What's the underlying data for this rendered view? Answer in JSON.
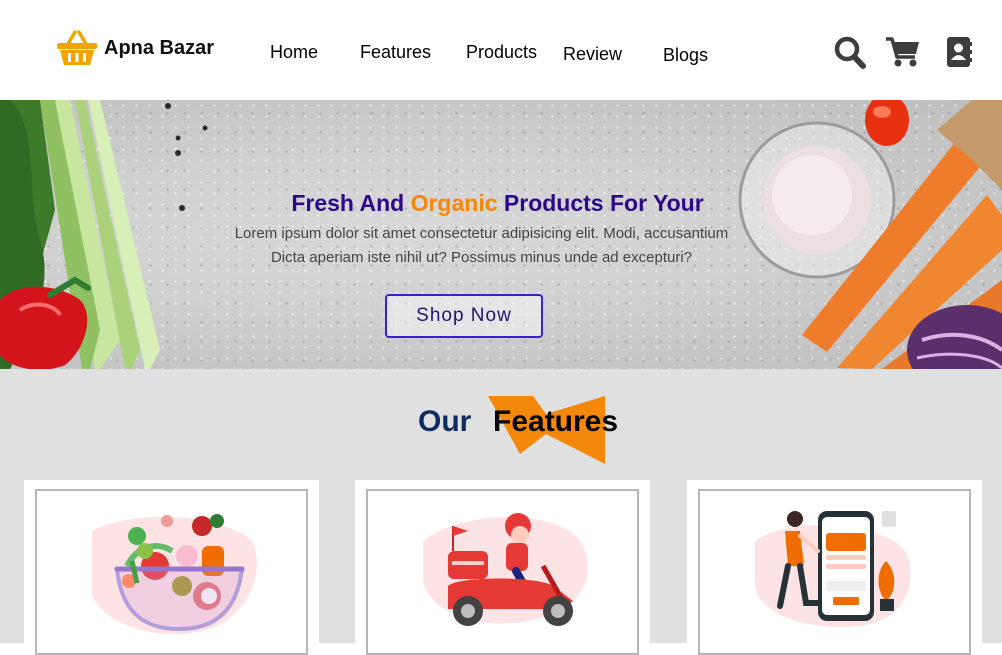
{
  "brand": {
    "name": "Apna Bazar",
    "logo_icon": "basket-icon",
    "accent": "#f4a300"
  },
  "nav": {
    "links": [
      "Home",
      "Features",
      "Products",
      "Review",
      "Blogs"
    ]
  },
  "header_icons": [
    "search-icon",
    "cart-icon",
    "contact-book-icon"
  ],
  "hero": {
    "title_before": "Fresh And ",
    "title_accent": "Organic",
    "title_after": " Products For Your",
    "subtitle_line1": "Lorem ipsum dolor sit amet consectetur adipisicing elit. Modi, accusantium",
    "subtitle_line2": "Dicta aperiam iste nihil ut? Possimus minus unde ad excepturi?",
    "cta_label": "Shop Now",
    "title_color": "#2a0a8a",
    "accent_color": "#f4880b"
  },
  "features": {
    "title_our": "Our",
    "title_features": "Features",
    "title_our_color": "#0d2b5e",
    "decor_color": "#f4880b",
    "cards": [
      {
        "illustration": "salad-bowl-illustration"
      },
      {
        "illustration": "scooter-delivery-illustration"
      },
      {
        "illustration": "mobile-payment-illustration"
      }
    ]
  }
}
